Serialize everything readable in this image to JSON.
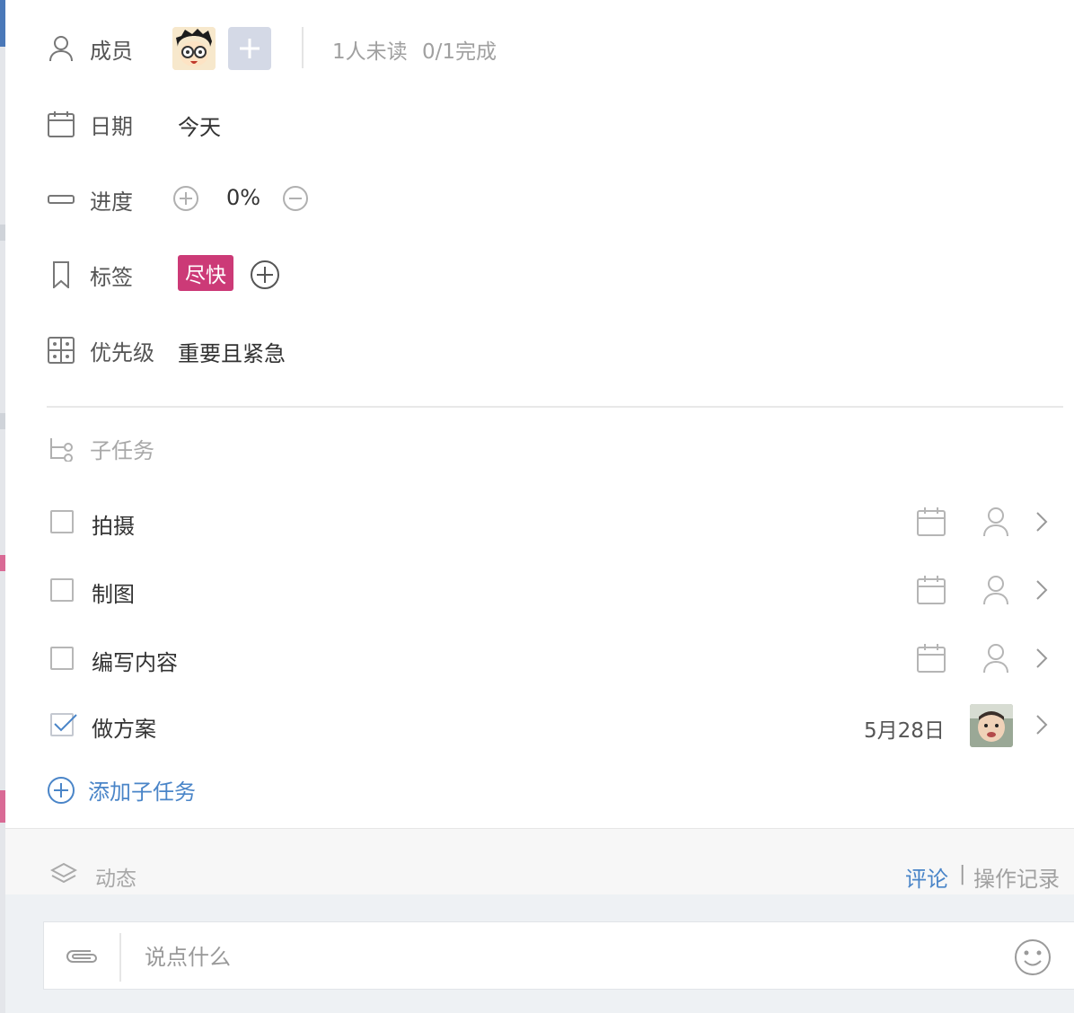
{
  "fields": {
    "members": {
      "label": "成员",
      "unread": "1人未读",
      "done": "0/1完成"
    },
    "date": {
      "label": "日期",
      "value": "今天"
    },
    "progress": {
      "label": "进度",
      "value": "0%"
    },
    "tags": {
      "label": "标签",
      "items": [
        {
          "text": "尽快",
          "color": "#cc3a77"
        }
      ]
    },
    "priority": {
      "label": "优先级",
      "value": "重要且紧急"
    }
  },
  "subtasks": {
    "header": "子任务",
    "items": [
      {
        "title": "拍摄",
        "checked": false
      },
      {
        "title": "制图",
        "checked": false
      },
      {
        "title": "编写内容",
        "checked": false
      },
      {
        "title": "做方案",
        "checked": true,
        "date": "5月28日"
      }
    ],
    "add_label": "添加子任务"
  },
  "activity": {
    "label": "动态",
    "comment_tab": "评论",
    "separator": "|",
    "log_tab": "操作记录"
  },
  "composer": {
    "placeholder": "说点什么"
  },
  "colors": {
    "accent": "#4a85c8",
    "tag": "#cc3a77",
    "muted": "#a2a2a2"
  }
}
